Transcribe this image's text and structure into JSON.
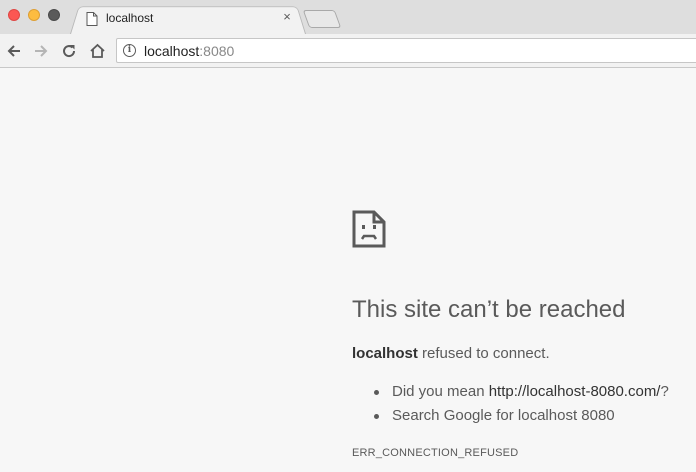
{
  "window": {
    "controls": [
      "close",
      "minimize",
      "maximize"
    ]
  },
  "tab": {
    "title": "localhost",
    "favicon": "page-icon",
    "close_glyph": "×"
  },
  "toolbar": {
    "back_icon": "arrow-left-icon",
    "forward_icon": "arrow-right-icon",
    "reload_icon": "reload-icon",
    "home_icon": "home-icon"
  },
  "omnibox": {
    "host": "localhost",
    "port": ":8080",
    "info_glyph": "i"
  },
  "error_page": {
    "icon": "sad-page-icon",
    "headline": "This site can’t be reached",
    "detail_host": "localhost",
    "detail_text": " refused to connect.",
    "suggestions": [
      {
        "prefix": "Did you mean ",
        "link": "http://localhost-8080.com/",
        "suffix": "?"
      },
      {
        "prefix": "Search Google for localhost 8080",
        "link": "",
        "suffix": ""
      }
    ],
    "error_code": "ERR_CONNECTION_REFUSED"
  },
  "colors": {
    "close": "#fc5753",
    "minimize": "#fdbc40",
    "maximize": "#5a5a5a",
    "text": "#5a5a5a",
    "page_bg": "#f7f7f7"
  }
}
